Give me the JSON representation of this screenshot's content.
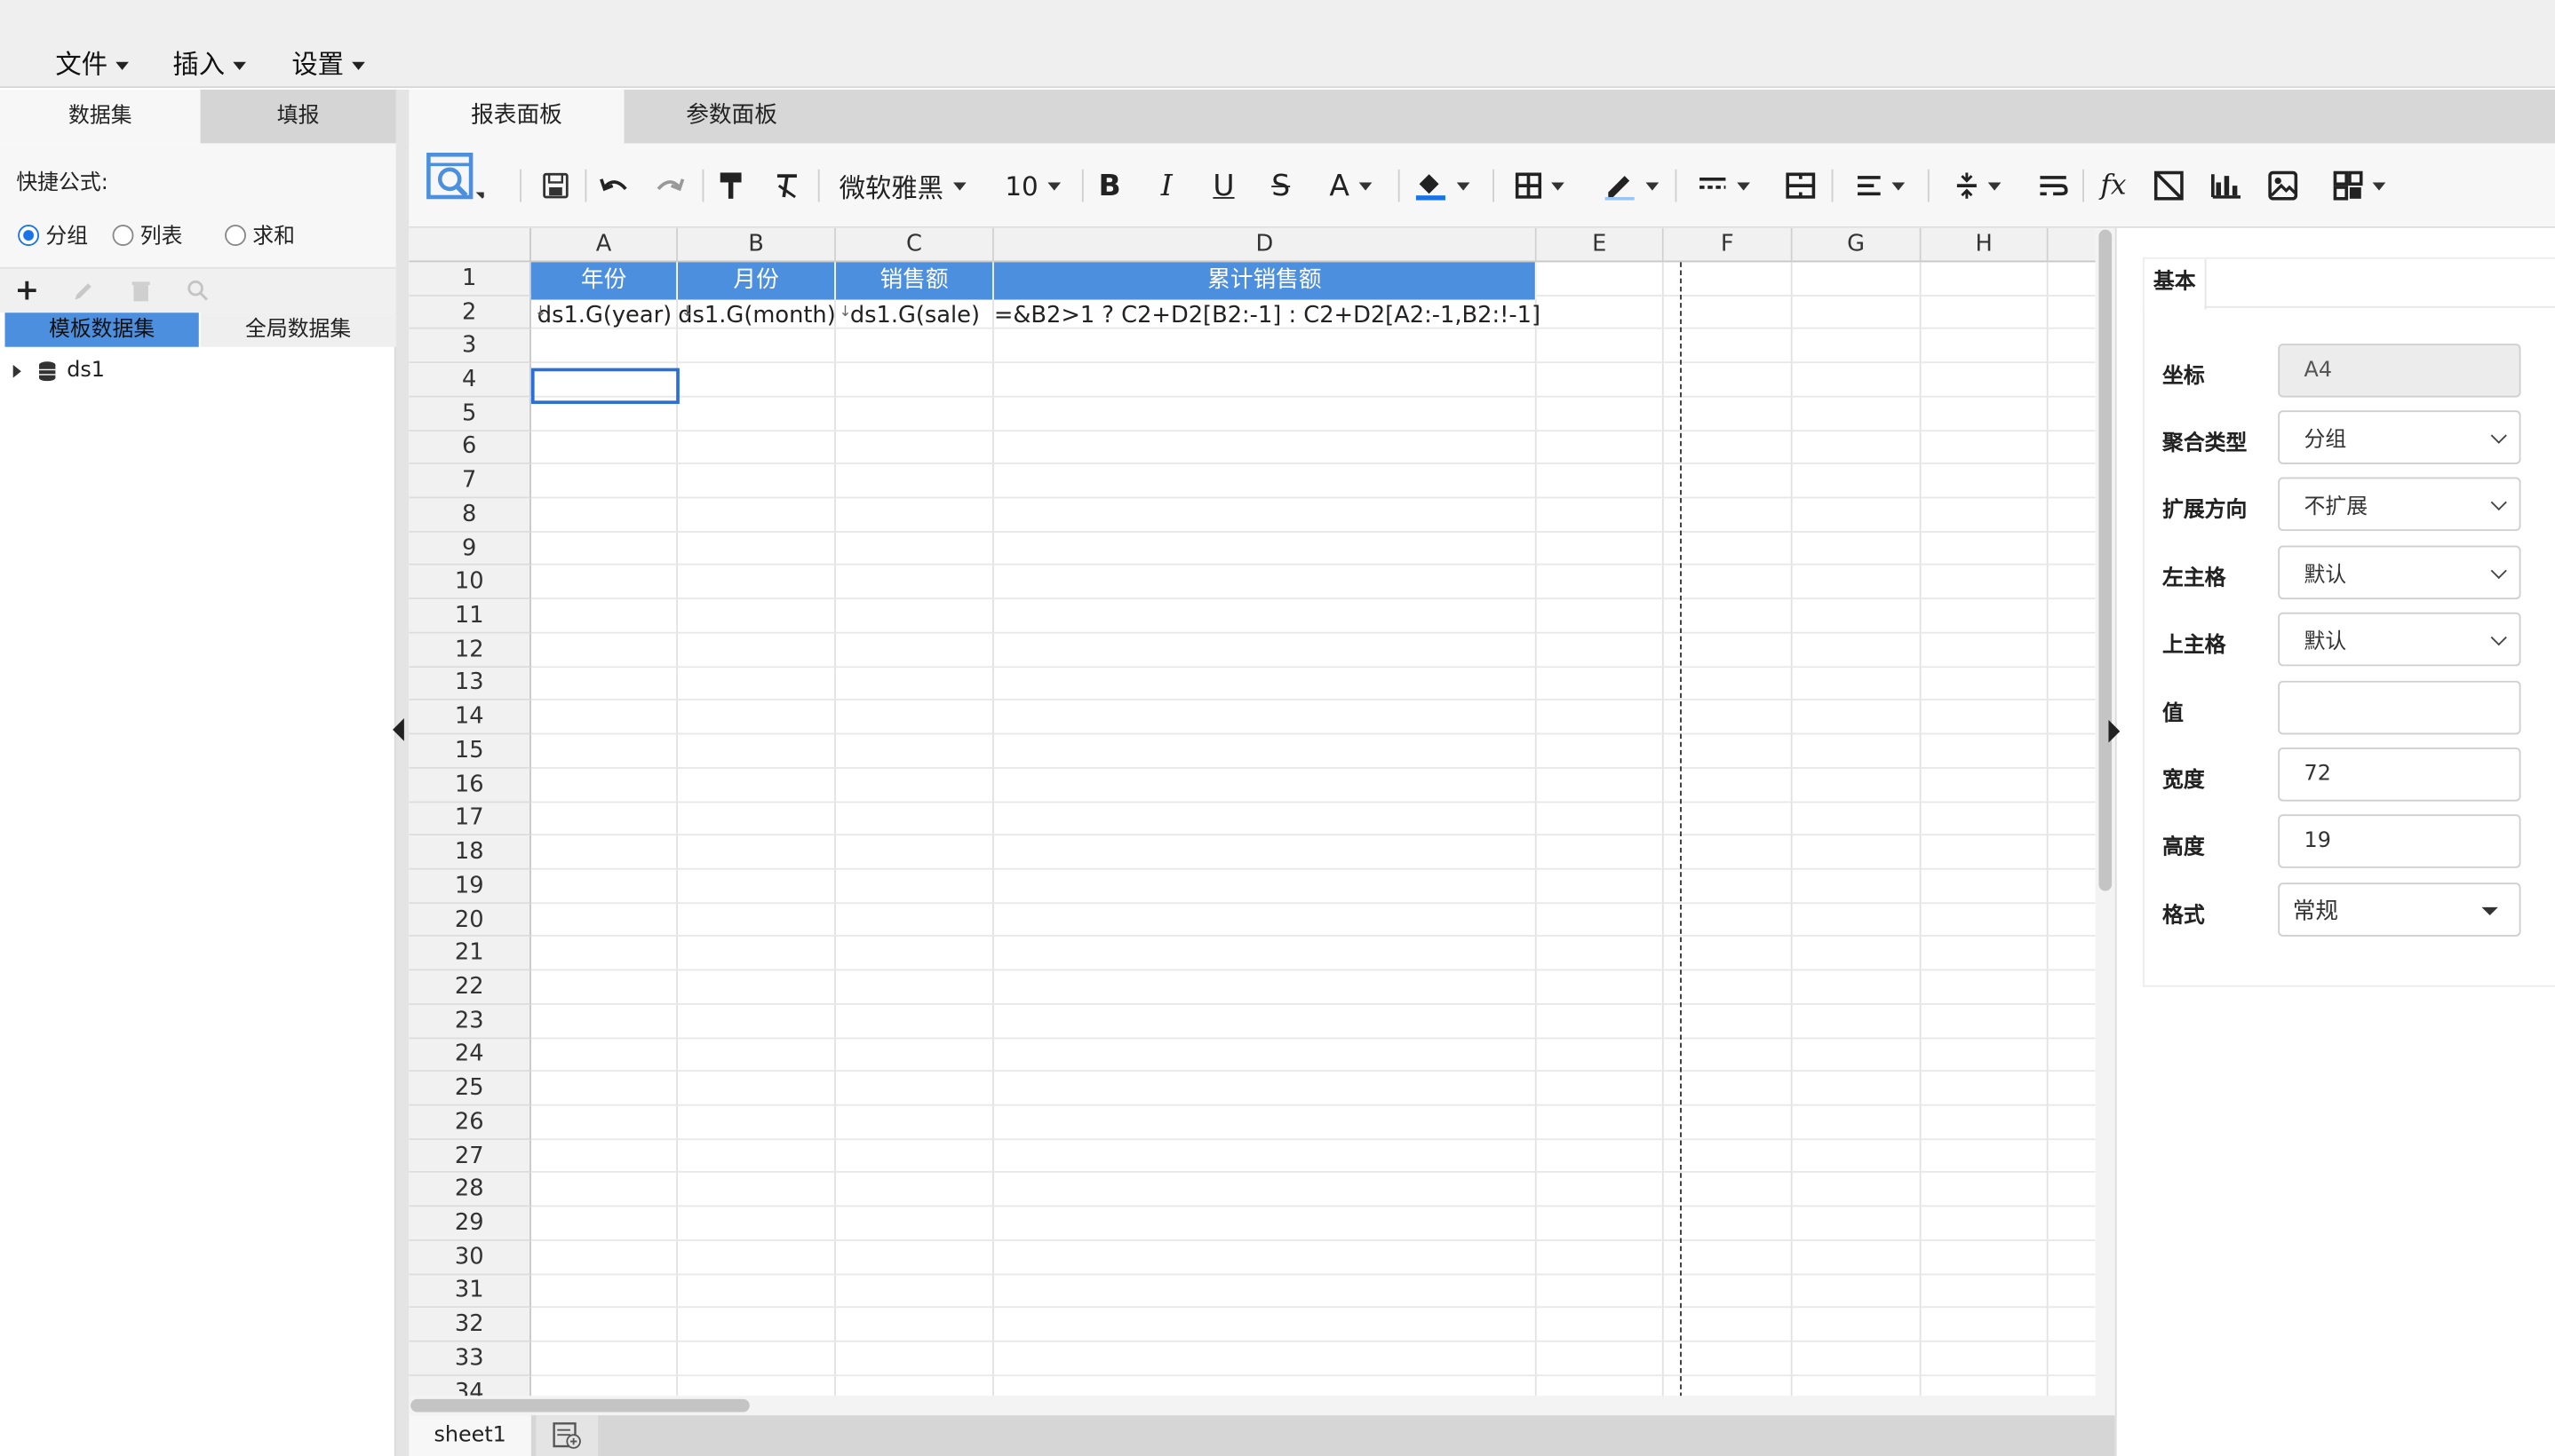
{
  "menubar": {
    "items": [
      "文件",
      "插入",
      "设置"
    ]
  },
  "left_panel": {
    "tabs": [
      "数据集",
      "填报"
    ],
    "quick_formula_label": "快捷公式:",
    "radios": [
      {
        "label": "分组",
        "checked": true
      },
      {
        "label": "列表",
        "checked": false
      },
      {
        "label": "求和",
        "checked": false
      }
    ],
    "dataset_tabs": [
      "模板数据集",
      "全局数据集"
    ],
    "tree": [
      {
        "label": "ds1",
        "icon": "database-icon"
      }
    ]
  },
  "center": {
    "tabs": [
      "报表面板",
      "参数面板"
    ],
    "toolbar": {
      "font_family": "微软雅黑",
      "font_size": "10"
    },
    "columns": [
      "A",
      "B",
      "C",
      "D",
      "E",
      "F",
      "G",
      "H"
    ],
    "rows": [
      "1",
      "2",
      "3",
      "4",
      "5",
      "6",
      "7",
      "8",
      "9",
      "10",
      "11",
      "12",
      "13",
      "14",
      "15",
      "16",
      "17",
      "18",
      "19",
      "20",
      "21",
      "22",
      "23",
      "24",
      "25",
      "26",
      "27",
      "28",
      "29",
      "30",
      "31",
      "32",
      "33",
      "34"
    ],
    "header_cells": [
      "年份",
      "月份",
      "销售额",
      "累计销售额"
    ],
    "formula_cells": [
      "ds1.G(year)",
      "ds1.G(month)",
      "ds1.G(sale)",
      "=&B2>1 ? C2+D2[B2:-1] : C2+D2[A2:-1,B2:!-1]"
    ],
    "selected_cell": "A4"
  },
  "sheet_tabs": [
    "sheet1"
  ],
  "right_panel": {
    "tab": "基本",
    "fields": [
      {
        "label": "坐标",
        "value": "A4",
        "kind": "readonly"
      },
      {
        "label": "聚合类型",
        "value": "分组",
        "kind": "select"
      },
      {
        "label": "扩展方向",
        "value": "不扩展",
        "kind": "select"
      },
      {
        "label": "左主格",
        "value": "默认",
        "kind": "select"
      },
      {
        "label": "上主格",
        "value": "默认",
        "kind": "select"
      },
      {
        "label": "值",
        "value": "",
        "kind": "input"
      },
      {
        "label": "宽度",
        "value": "72",
        "kind": "input"
      },
      {
        "label": "高度",
        "value": "19",
        "kind": "input"
      },
      {
        "label": "格式",
        "value": "常规",
        "kind": "dropdown"
      }
    ]
  },
  "colors": {
    "accent": "#4c8fdf",
    "selection": "#2b6fd6",
    "active_tab": "#f7f7f7"
  }
}
